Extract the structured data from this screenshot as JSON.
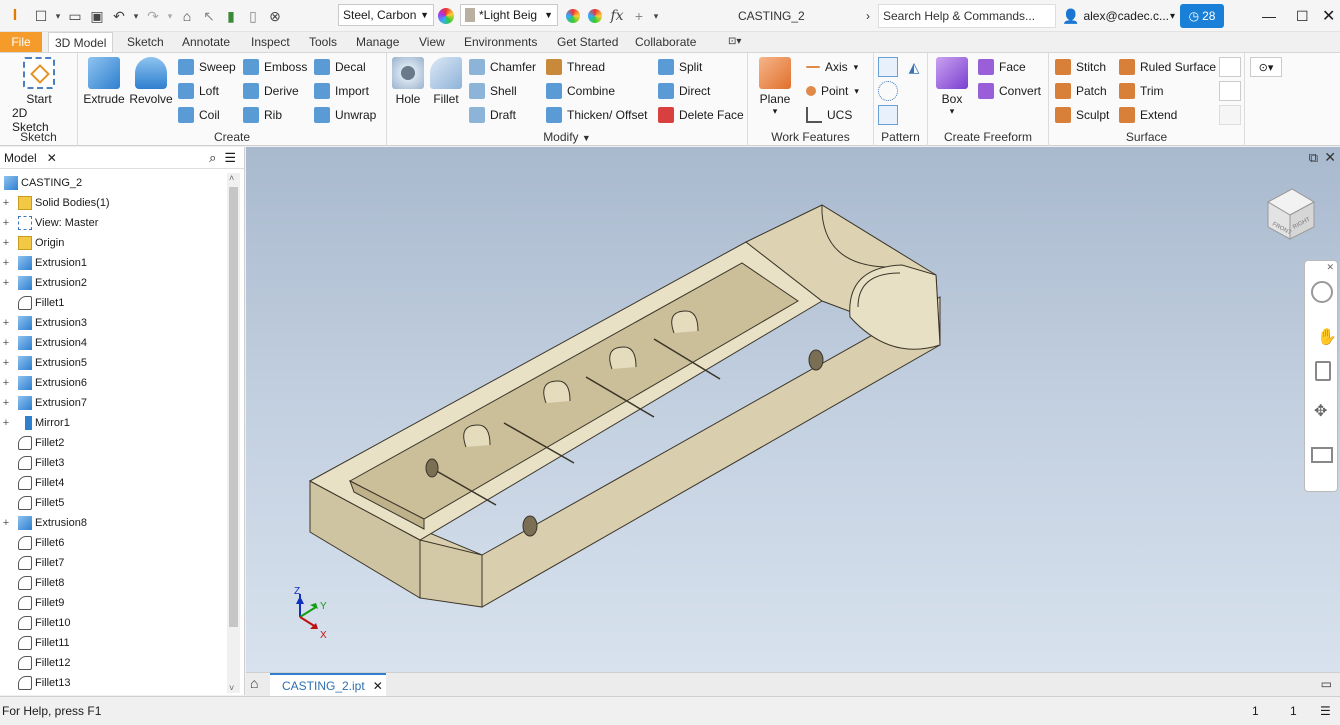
{
  "title_bar": {
    "app_logo": "I",
    "material": "Steel, Carbon",
    "appearance": "*Light Beig",
    "document_title": "CASTING_2",
    "search_placeholder": "Search Help & Commands...",
    "user": "alex@cadec.c...",
    "clock_count": "28"
  },
  "tabs": [
    "File",
    "3D Model",
    "Sketch",
    "Annotate",
    "Inspect",
    "Tools",
    "Manage",
    "View",
    "Environments",
    "Get Started",
    "Collaborate"
  ],
  "ribbon": {
    "sketch": {
      "start": "Start",
      "sketch2d": "2D Sketch",
      "label": "Sketch"
    },
    "create": {
      "extrude": "Extrude",
      "revolve": "Revolve",
      "sweep": "Sweep",
      "loft": "Loft",
      "coil": "Coil",
      "emboss": "Emboss",
      "derive": "Derive",
      "rib": "Rib",
      "decal": "Decal",
      "import": "Import",
      "unwrap": "Unwrap",
      "label": "Create"
    },
    "modify": {
      "hole": "Hole",
      "fillet": "Fillet",
      "chamfer": "Chamfer",
      "shell": "Shell",
      "draft": "Draft",
      "thread": "Thread",
      "combine": "Combine",
      "thicken": "Thicken/ Offset",
      "split": "Split",
      "direct": "Direct",
      "delete_face": "Delete Face",
      "label": "Modify"
    },
    "work": {
      "plane": "Plane",
      "axis": "Axis",
      "point": "Point",
      "ucs": "UCS",
      "label": "Work Features"
    },
    "pattern": {
      "label": "Pattern"
    },
    "freeform": {
      "box": "Box",
      "face": "Face",
      "convert": "Convert",
      "label": "Create Freeform"
    },
    "surface": {
      "stitch": "Stitch",
      "patch": "Patch",
      "sculpt": "Sculpt",
      "ruled": "Ruled Surface",
      "trim": "Trim",
      "extend": "Extend",
      "label": "Surface"
    }
  },
  "browser": {
    "title": "Model",
    "root": "CASTING_2",
    "nodes": [
      {
        "label": "Solid Bodies(1)",
        "icon": "folder-icon",
        "exp": true
      },
      {
        "label": "View: Master",
        "icon": "view-icon",
        "exp": true
      },
      {
        "label": "Origin",
        "icon": "folder-icon",
        "exp": true
      },
      {
        "label": "Extrusion1",
        "icon": "extrusion-icon",
        "exp": true
      },
      {
        "label": "Extrusion2",
        "icon": "extrusion-icon",
        "exp": true
      },
      {
        "label": "Fillet1",
        "icon": "fillet-icon",
        "exp": false
      },
      {
        "label": "Extrusion3",
        "icon": "extrusion-icon",
        "exp": true
      },
      {
        "label": "Extrusion4",
        "icon": "extrusion-icon",
        "exp": true
      },
      {
        "label": "Extrusion5",
        "icon": "extrusion-icon",
        "exp": true
      },
      {
        "label": "Extrusion6",
        "icon": "extrusion-icon",
        "exp": true
      },
      {
        "label": "Extrusion7",
        "icon": "extrusion-icon",
        "exp": true
      },
      {
        "label": "Mirror1",
        "icon": "mirror-icon",
        "exp": true
      },
      {
        "label": "Fillet2",
        "icon": "fillet-icon",
        "exp": false
      },
      {
        "label": "Fillet3",
        "icon": "fillet-icon",
        "exp": false
      },
      {
        "label": "Fillet4",
        "icon": "fillet-icon",
        "exp": false
      },
      {
        "label": "Fillet5",
        "icon": "fillet-icon",
        "exp": false
      },
      {
        "label": "Extrusion8",
        "icon": "extrusion-icon",
        "exp": true
      },
      {
        "label": "Fillet6",
        "icon": "fillet-icon",
        "exp": false
      },
      {
        "label": "Fillet7",
        "icon": "fillet-icon",
        "exp": false
      },
      {
        "label": "Fillet8",
        "icon": "fillet-icon",
        "exp": false
      },
      {
        "label": "Fillet9",
        "icon": "fillet-icon",
        "exp": false
      },
      {
        "label": "Fillet10",
        "icon": "fillet-icon",
        "exp": false
      },
      {
        "label": "Fillet11",
        "icon": "fillet-icon",
        "exp": false
      },
      {
        "label": "Fillet12",
        "icon": "fillet-icon",
        "exp": false
      },
      {
        "label": "Fillet13",
        "icon": "fillet-icon",
        "exp": false
      }
    ]
  },
  "viewcube": {
    "face_front": "FRONT",
    "face_right": "RIGHT"
  },
  "axes": {
    "x": "X",
    "y": "Y",
    "z": "Z"
  },
  "doc_tab": "CASTING_2.ipt",
  "status": {
    "help": "For Help, press F1",
    "count1": "1",
    "count2": "1"
  },
  "colors": {
    "accent": "#f59b2a",
    "part": "#e5dcbe",
    "clock": "#1a7fd6"
  }
}
